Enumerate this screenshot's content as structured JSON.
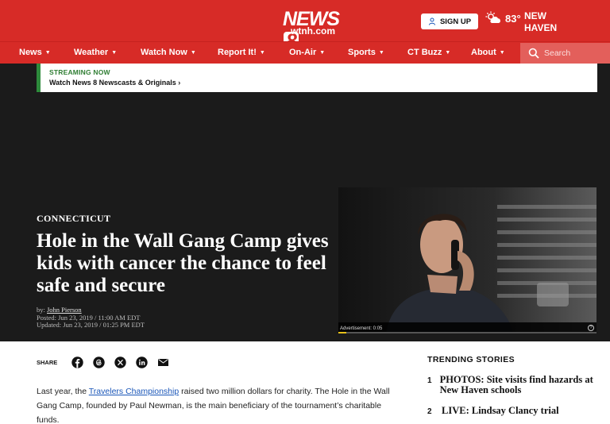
{
  "header": {
    "logo_main": "NEWS",
    "logo_eight": "8",
    "logo_sub": "wtnh.com",
    "signup_label": "SIGN UP",
    "temperature": "83°",
    "city": "NEW HAVEN"
  },
  "nav": {
    "items": [
      "News",
      "Weather",
      "Watch Now",
      "Report It!",
      "On-Air",
      "Sports",
      "CT Buzz",
      "About"
    ],
    "search_placeholder": "Search"
  },
  "streaming": {
    "label": "STREAMING NOW",
    "link": "Watch News 8 Newscasts & Originals"
  },
  "article": {
    "kicker": "CONNECTICUT",
    "headline": "Hole in the Wall Gang Camp gives kids with cancer the chance to feel safe and secure",
    "by_prefix": "by: ",
    "author": "John Pierson",
    "posted": "Posted: Jun 23, 2019 / 11:00 AM EDT",
    "updated": "Updated: Jun 23, 2019 / 01:25 PM EDT",
    "body_prefix": "Last year, the ",
    "body_link": "Travelers Championship",
    "body_rest": " raised two million dollars for charity. The Hole in the Wall Gang Camp, founded by Paul Newman, is the main beneficiary of the tournament’s charitable funds."
  },
  "player": {
    "ad_text": "Advertisement: 0:05",
    "progress": 0.03,
    "help": "?"
  },
  "share": {
    "label": "SHARE"
  },
  "trending": {
    "title": "TRENDING STORIES",
    "items": [
      {
        "num": "1",
        "text": "PHOTOS: Site visits find hazards at New Haven schools"
      },
      {
        "num": "2",
        "text": "LIVE: Lindsay Clancy trial"
      }
    ]
  },
  "colors": {
    "brand_red": "#d72b27",
    "streaming_green": "#2e8b3c",
    "link_blue": "#1a56b8",
    "ad_progress": "#e7c11a"
  }
}
